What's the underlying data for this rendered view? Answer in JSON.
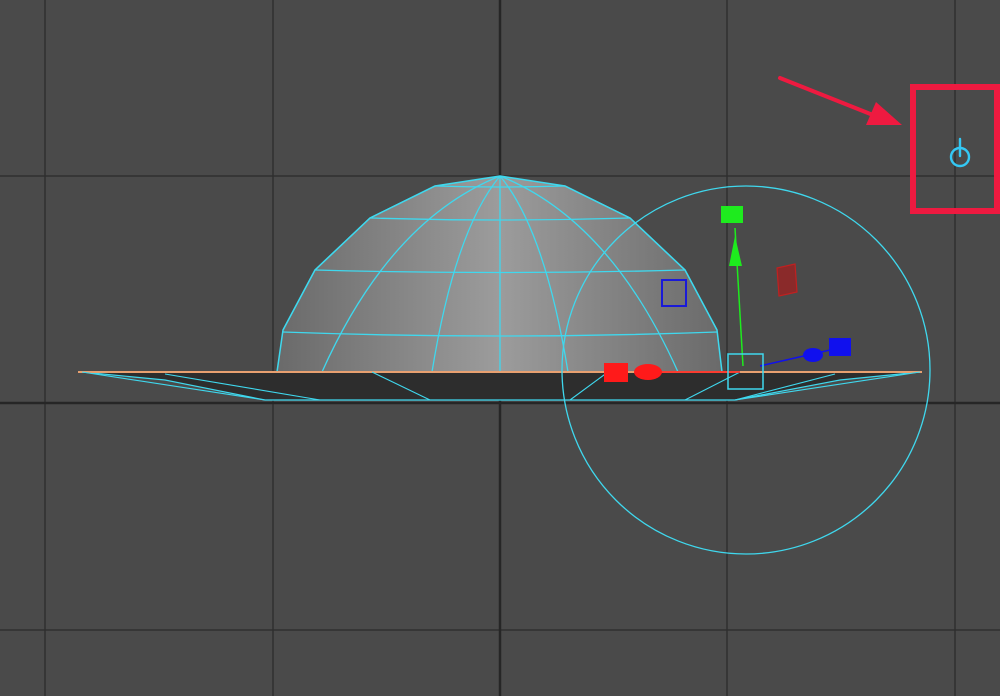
{
  "viewport": {
    "background": "#4a4a4a",
    "grid_color": "#2f2f2f",
    "grid_axis_color": "#262626"
  },
  "selection": {
    "wireframe_color": "#3fd8ee",
    "ground_edge_color": "#e8a070"
  },
  "manipulator": {
    "x_axis_color": "#ff1a1a",
    "y_axis_color": "#1eeb1e",
    "z_axis_color": "#1010ee",
    "rotate_ring_color": "#3fd8ee"
  },
  "annotation": {
    "highlight_color": "#ee1a40",
    "target": "pivot-toggle-icon",
    "icon_color": "#34c8f4"
  }
}
